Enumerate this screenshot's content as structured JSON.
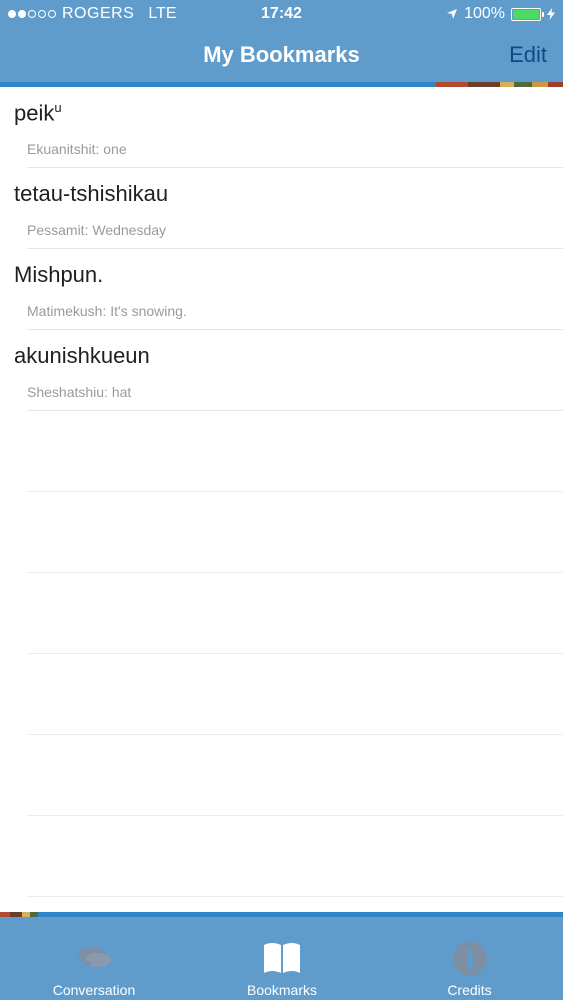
{
  "status": {
    "carrier": "ROGERS",
    "network": "LTE",
    "time": "17:42",
    "battery": "100%"
  },
  "nav": {
    "title": "My Bookmarks",
    "edit_label": "Edit"
  },
  "bookmarks": [
    {
      "term": "peik",
      "sup": "u",
      "translation": "Ekuanitshit: one"
    },
    {
      "term": "tetau-tshishikau",
      "sup": "",
      "translation": "Pessamit: Wednesday"
    },
    {
      "term": "Mishpun.",
      "sup": "",
      "translation": "Matimekush: It's snowing."
    },
    {
      "term": "akunishkueun",
      "sup": "",
      "translation": "Sheshatshiu: hat"
    }
  ],
  "tabs": [
    {
      "label": "Conversation",
      "icon": "chat-icon"
    },
    {
      "label": "Bookmarks",
      "icon": "book-icon"
    },
    {
      "label": "Credits",
      "icon": "info-icon"
    }
  ],
  "colors": {
    "bar": "#5f9ccc",
    "stripe": "#2f86c6",
    "accent": [
      "#b24a32",
      "#6b3d2b",
      "#d6b15a",
      "#4f6a3b",
      "#c89a45"
    ]
  }
}
